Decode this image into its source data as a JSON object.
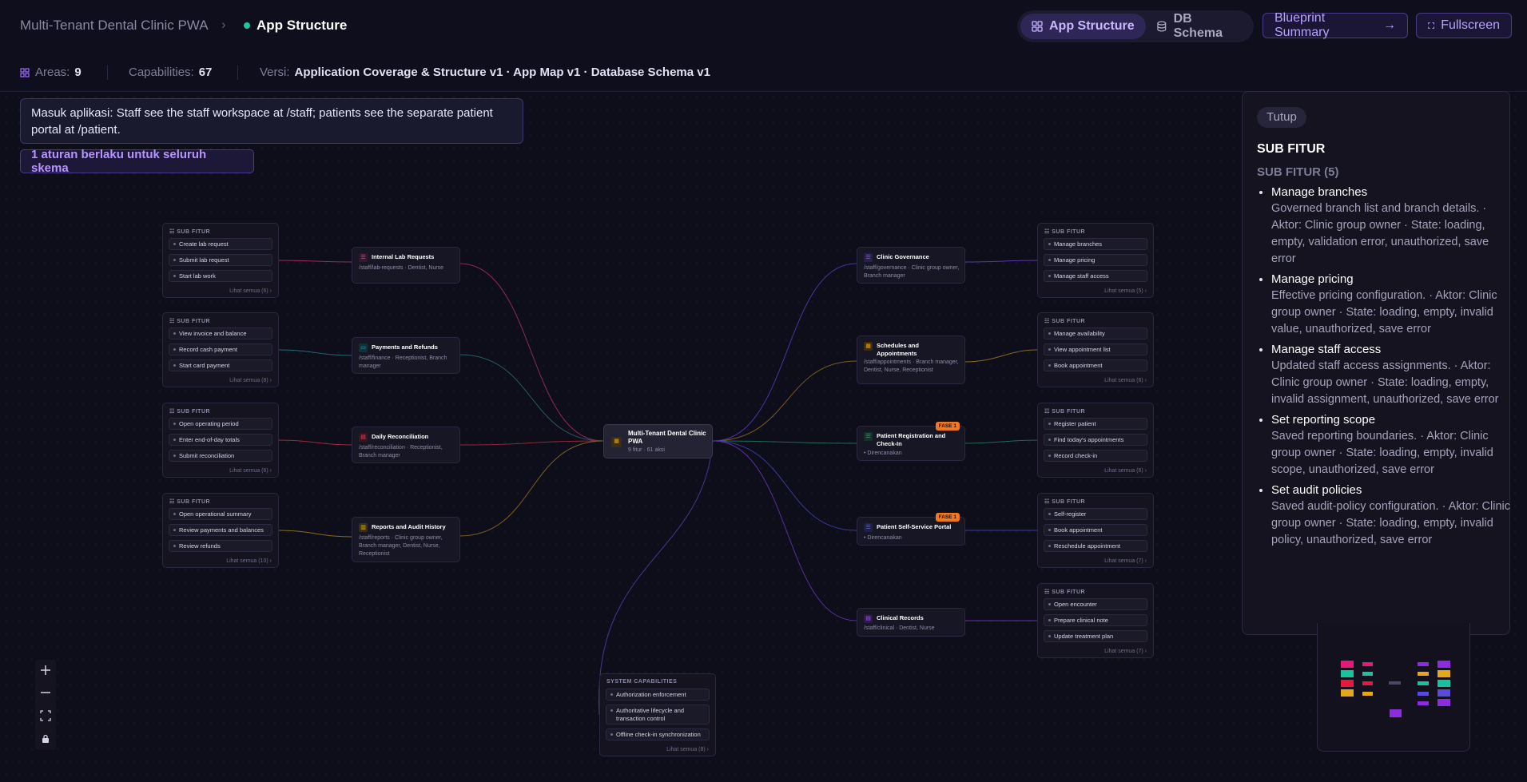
{
  "header": {
    "breadcrumb_root": "Multi-Tenant Dental Clinic PWA",
    "breadcrumb_current": "App Structure",
    "tabs": [
      {
        "label": "App Structure",
        "icon": "grid-icon",
        "active": true
      },
      {
        "label": "DB Schema",
        "icon": "database-icon",
        "active": false
      }
    ],
    "blueprint_button": "Blueprint Summary",
    "fullscreen_button": "Fullscreen"
  },
  "stats": {
    "areas_label": "Areas:",
    "areas_value": "9",
    "capabilities_label": "Capabilities:",
    "capabilities_value": "67",
    "version_label": "Versi:",
    "version_value": "Application Coverage & Structure v1 · App Map v1 · Database Schema v1"
  },
  "intro": {
    "entry_text": "Masuk aplikasi: Staff see the staff workspace at /staff; patients see the separate patient portal at /patient.",
    "rule_button": "1 aturan berlaku untuk seluruh skema"
  },
  "center_node": {
    "title": "Multi-Tenant Dental Clinic PWA",
    "meta": "9 fitur · 61 aksi"
  },
  "subfitur_label": "SUB FITUR",
  "left_features": [
    {
      "title": "Internal Lab Requests",
      "sub": "/staff/lab-requests · Dentist, Nurse",
      "color": "#ec4899"
    },
    {
      "title": "Payments and Refunds",
      "sub": "/staff/finance · Receptionist, Branch manager",
      "color": "#22c1c3"
    },
    {
      "title": "Daily Reconciliation",
      "sub": "/staff/reconciliation · Receptionist, Branch manager",
      "color": "#f43f5e"
    },
    {
      "title": "Reports and Audit History",
      "sub": "/staff/reports · Clinic group owner, Branch manager, Dentist, Nurse, Receptionist",
      "color": "#eab308"
    }
  ],
  "right_features": [
    {
      "title": "Clinic Governance",
      "sub": "/staff/governance · Clinic group owner, Branch manager",
      "color": "#8b5cf6",
      "badge": "",
      "planned": ""
    },
    {
      "title": "Schedules and Appointments",
      "sub": "/staff/appointments · Branch manager, Dentist, Nurse, Receptionist",
      "color": "#f59e0b",
      "badge": "",
      "planned": ""
    },
    {
      "title": "Patient Registration and Check-In",
      "sub": "",
      "color": "#10b981",
      "badge": "FASE 1",
      "planned": "Direncanakan"
    },
    {
      "title": "Patient Self-Service Portal",
      "sub": "",
      "color": "#6366f1",
      "badge": "FASE 1",
      "planned": "Direncanakan"
    },
    {
      "title": "Clinical Records",
      "sub": "/staff/clinical · Dentist, Nurse",
      "color": "#a855f7",
      "badge": "",
      "planned": ""
    }
  ],
  "left_groups": [
    {
      "items": [
        "Create lab request",
        "Submit lab request",
        "Start lab work"
      ],
      "more": "Lihat semua (6)"
    },
    {
      "items": [
        "View invoice and balance",
        "Record cash payment",
        "Start card payment"
      ],
      "more": "Lihat semua (8)"
    },
    {
      "items": [
        "Open operating period",
        "Enter end-of-day totals",
        "Submit reconciliation"
      ],
      "more": "Lihat semua (6)"
    },
    {
      "items": [
        "Open operational summary",
        "Review payments and balances",
        "Review refunds"
      ],
      "more": "Lihat semua (10)"
    }
  ],
  "right_groups": [
    {
      "items": [
        "Manage branches",
        "Manage pricing",
        "Manage staff access"
      ],
      "more": "Lihat semua (5)"
    },
    {
      "items": [
        "Manage availability",
        "View appointment list",
        "Book appointment"
      ],
      "more": "Lihat semua (6)"
    },
    {
      "items": [
        "Register patient",
        "Find today's appointments",
        "Record check-in"
      ],
      "more": "Lihat semua (6)"
    },
    {
      "items": [
        "Self-register",
        "Book appointment",
        "Reschedule appointment"
      ],
      "more": "Lihat semua (7)"
    },
    {
      "items": [
        "Open encounter",
        "Prepare clinical note",
        "Update treatment plan"
      ],
      "more": "Lihat semua (7)"
    }
  ],
  "system": {
    "title": "SYSTEM CAPABILITIES",
    "items": [
      "Authorization enforcement",
      "Authoritative lifecycle and transaction control",
      "Offline check-in synchronization"
    ],
    "more": "Lihat semua (8)"
  },
  "panel": {
    "close": "Tutup",
    "heading": "SUB FITUR",
    "subheading": "SUB FITUR (5)",
    "items": [
      {
        "name": "Manage branches",
        "desc": "Governed branch list and branch details. · Aktor: Clinic group owner · State: loading, empty, validation error, unauthorized, save error"
      },
      {
        "name": "Manage pricing",
        "desc": "Effective pricing configuration. · Aktor: Clinic group owner · State: loading, empty, invalid value, unauthorized, save error"
      },
      {
        "name": "Manage staff access",
        "desc": "Updated staff access assignments. · Aktor: Clinic group owner · State: loading, empty, invalid assignment, unauthorized, save error"
      },
      {
        "name": "Set reporting scope",
        "desc": "Saved reporting boundaries. · Aktor: Clinic group owner · State: loading, empty, invalid scope, unauthorized, save error"
      },
      {
        "name": "Set audit policies",
        "desc": "Saved audit-policy configuration. · Aktor: Clinic group owner · State: loading, empty, invalid policy, unauthorized, save error"
      }
    ]
  },
  "colors": {
    "accent": "#8b5cf6",
    "accent_text": "#b795ff",
    "background": "#0e0d1a",
    "badge": "#f07820",
    "status_dot": "#1fc59a"
  }
}
